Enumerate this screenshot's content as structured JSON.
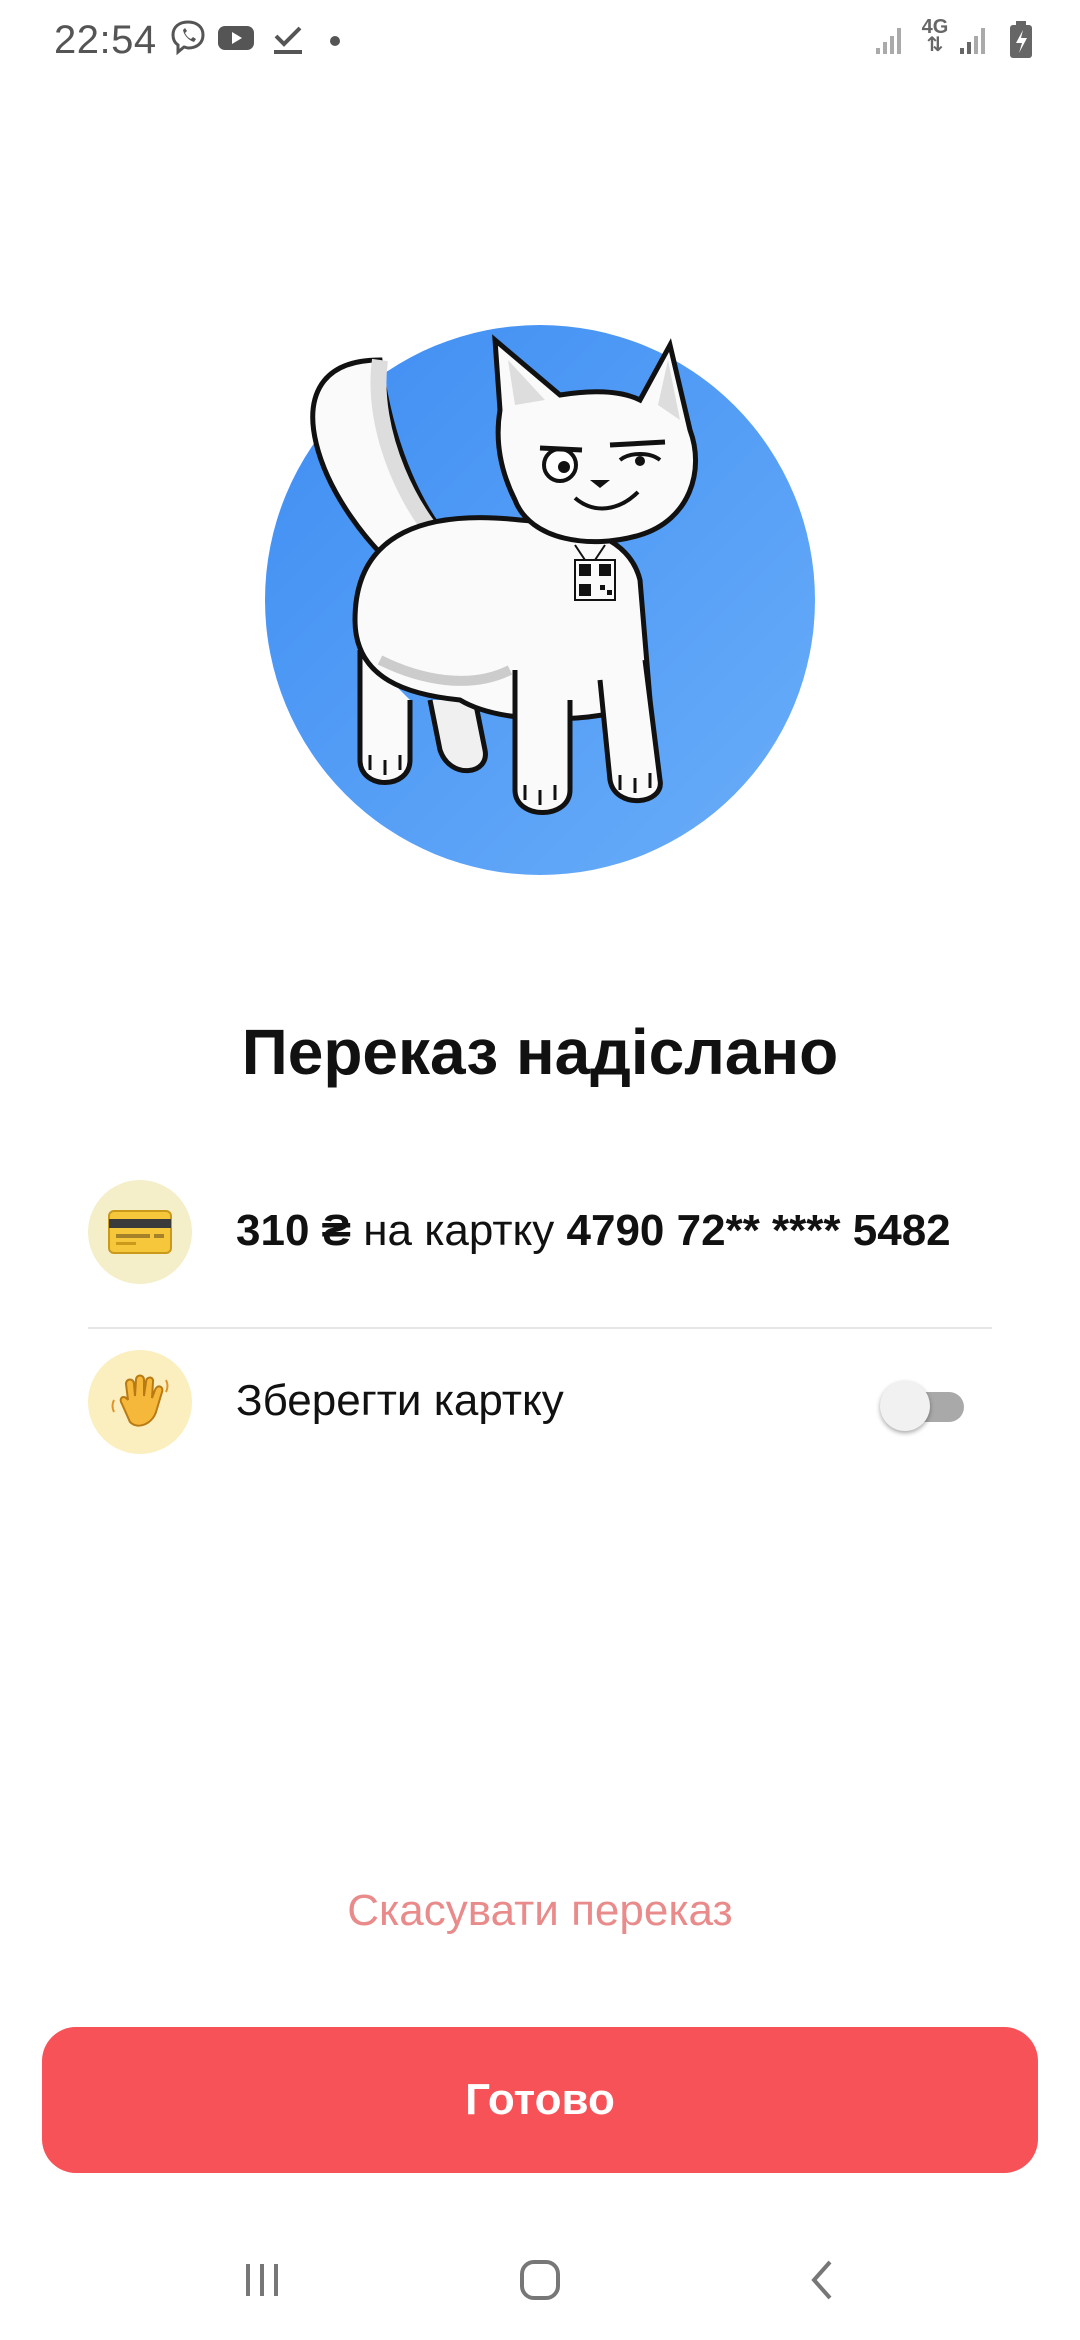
{
  "status_bar": {
    "time": "22:54",
    "network_label": "4G",
    "icons": [
      "viber-icon",
      "youtube-icon",
      "download-done-icon",
      "notification-dot",
      "signal-icon",
      "signal-icon",
      "battery-charging-icon"
    ]
  },
  "illustration": {
    "icon": "cat-illustration",
    "circle_color": "#4a97f5"
  },
  "title": "Переказ надіслано",
  "transfer_row": {
    "icon": "credit-card-icon",
    "amount": "310 ₴",
    "middle_text": " на картку ",
    "card_number": "4790 72** **** 5482"
  },
  "save_card_row": {
    "icon": "waving-hand-icon",
    "label": "Зберегти картку",
    "toggle_on": false
  },
  "cancel_link": "Скасувати переказ",
  "done_button": "Готово",
  "nav_bar": {
    "items": [
      "recent-apps-icon",
      "home-icon",
      "back-icon"
    ]
  },
  "colors": {
    "accent": "#f75257",
    "cancel_text": "#e98b8b",
    "illustration_blue": "#4a97f5"
  }
}
